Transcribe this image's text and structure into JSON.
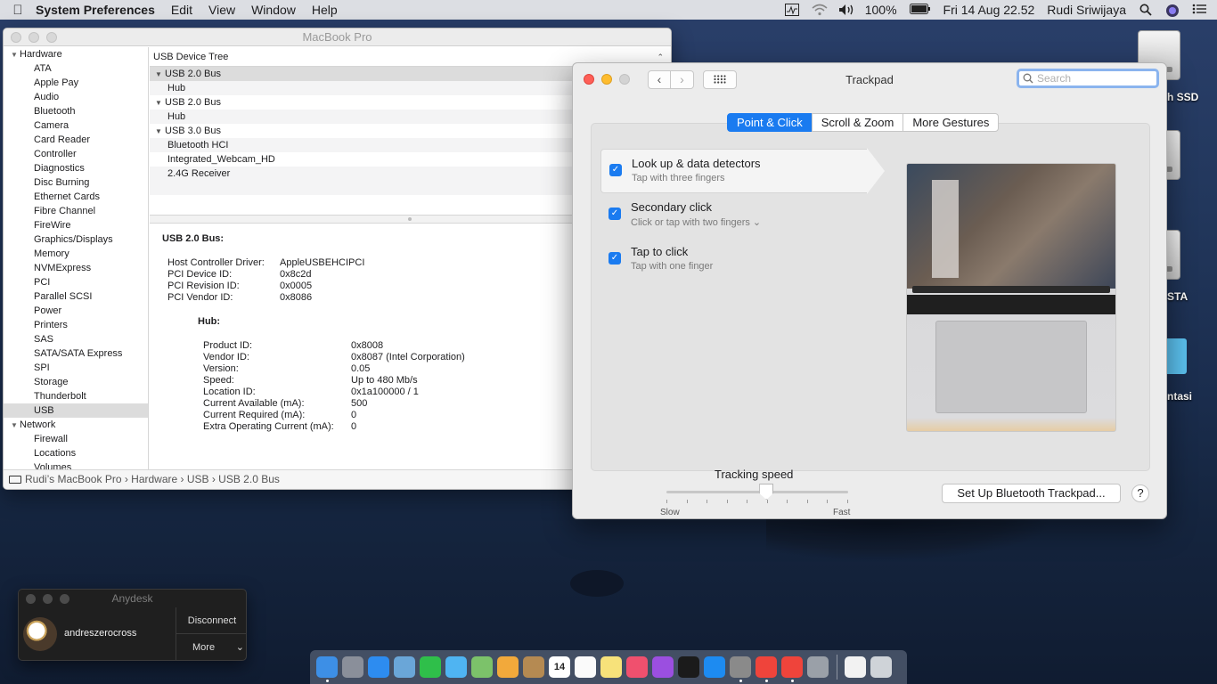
{
  "menubar": {
    "app_name": "System Preferences",
    "items": [
      "Edit",
      "View",
      "Window",
      "Help"
    ],
    "battery": "100%",
    "datetime": "Fri 14 Aug  22.52",
    "user": "Rudi Sriwijaya"
  },
  "desktop": {
    "labels": [
      "h SSD",
      "STA",
      "ntasi"
    ]
  },
  "sysinfo": {
    "title": "MacBook Pro",
    "sidebar_groups": [
      {
        "label": "Hardware",
        "items": [
          "ATA",
          "Apple Pay",
          "Audio",
          "Bluetooth",
          "Camera",
          "Card Reader",
          "Controller",
          "Diagnostics",
          "Disc Burning",
          "Ethernet Cards",
          "Fibre Channel",
          "FireWire",
          "Graphics/Displays",
          "Memory",
          "NVMExpress",
          "PCI",
          "Parallel SCSI",
          "Power",
          "Printers",
          "SAS",
          "SATA/SATA Express",
          "SPI",
          "Storage",
          "Thunderbolt",
          "USB"
        ]
      },
      {
        "label": "Network",
        "items": [
          "Firewall",
          "Locations",
          "Volumes"
        ]
      }
    ],
    "selected_item": "USB",
    "tree_header": "USB Device Tree",
    "tree": [
      {
        "label": "USB 2.0 Bus",
        "type": "bus"
      },
      {
        "label": "Hub",
        "type": "device"
      },
      {
        "label": "USB 2.0 Bus",
        "type": "bus"
      },
      {
        "label": "Hub",
        "type": "device"
      },
      {
        "label": "USB 3.0 Bus",
        "type": "bus"
      },
      {
        "label": "Bluetooth HCI",
        "type": "device"
      },
      {
        "label": "Integrated_Webcam_HD",
        "type": "device"
      },
      {
        "label": "2.4G Receiver",
        "type": "device"
      }
    ],
    "detail": {
      "heading": "USB 2.0 Bus:",
      "bus_props": [
        [
          "Host Controller Driver:",
          "AppleUSBEHCIPCI"
        ],
        [
          "PCI Device ID:",
          "0x8c2d"
        ],
        [
          "PCI Revision ID:",
          "0x0005"
        ],
        [
          "PCI Vendor ID:",
          "0x8086"
        ]
      ],
      "hub_heading": "Hub:",
      "hub_props": [
        [
          "Product ID:",
          "0x8008"
        ],
        [
          "Vendor ID:",
          "0x8087  (Intel Corporation)"
        ],
        [
          "Version:",
          "0.05"
        ],
        [
          "Speed:",
          "Up to 480 Mb/s"
        ],
        [
          "Location ID:",
          "0x1a100000 / 1"
        ],
        [
          "Current Available (mA):",
          "500"
        ],
        [
          "Current Required (mA):",
          "0"
        ],
        [
          "Extra Operating Current (mA):",
          "0"
        ]
      ]
    },
    "path": "Rudi’s MacBook Pro › Hardware › USB › USB 2.0 Bus"
  },
  "trackpad": {
    "title": "Trackpad",
    "search_placeholder": "Search",
    "tabs": [
      "Point & Click",
      "Scroll & Zoom",
      "More Gestures"
    ],
    "active_tab": 0,
    "options": [
      {
        "title": "Look up & data detectors",
        "subtitle": "Tap with three fingers",
        "checked": true
      },
      {
        "title": "Secondary click",
        "subtitle": "Click or tap with two fingers ⌄",
        "checked": true
      },
      {
        "title": "Tap to click",
        "subtitle": "Tap with one finger",
        "checked": true
      }
    ],
    "tracking_speed_label": "Tracking speed",
    "slider_min_label": "Slow",
    "slider_max_label": "Fast",
    "tracking_speed_value": 0.55,
    "bt_button": "Set Up Bluetooth Trackpad...",
    "help_button": "?"
  },
  "anydesk": {
    "title": "Anydesk",
    "user": "andreszerocross",
    "disconnect": "Disconnect",
    "more": "More"
  },
  "dock": {
    "calendar_day": "14",
    "apps": [
      {
        "name": "finder-icon",
        "color": "#3d8fe6"
      },
      {
        "name": "launchpad-icon",
        "color": "#8a8f9a"
      },
      {
        "name": "safari-icon",
        "color": "#2d8cf0"
      },
      {
        "name": "preview-icon",
        "color": "#6aa6d8"
      },
      {
        "name": "facetime-icon",
        "color": "#2fbf4a"
      },
      {
        "name": "messages-icon",
        "color": "#4fb4f2"
      },
      {
        "name": "maps-icon",
        "color": "#7cc26a"
      },
      {
        "name": "photos-icon",
        "color": "#f2a93b"
      },
      {
        "name": "contacts-icon",
        "color": "#b58a52"
      },
      {
        "name": "calendar-icon",
        "color": "#ffffff"
      },
      {
        "name": "reminders-icon",
        "color": "#fafafa"
      },
      {
        "name": "notes-icon",
        "color": "#f7e27a"
      },
      {
        "name": "music-icon",
        "color": "#f0506e"
      },
      {
        "name": "podcasts-icon",
        "color": "#9b4fe0"
      },
      {
        "name": "tv-icon",
        "color": "#1b1b1b"
      },
      {
        "name": "app-store-icon",
        "color": "#1d8bf1"
      },
      {
        "name": "system-preferences-icon",
        "color": "#8a8a8a"
      },
      {
        "name": "anydesk-icon",
        "color": "#ef443b"
      },
      {
        "name": "anydesk-alt-icon",
        "color": "#ef443b"
      },
      {
        "name": "migration-icon",
        "color": "#9aa0a8"
      }
    ],
    "others": [
      {
        "name": "document-icon",
        "color": "#f2f2f2"
      },
      {
        "name": "trash-icon",
        "color": "#cfd3d8"
      }
    ]
  }
}
